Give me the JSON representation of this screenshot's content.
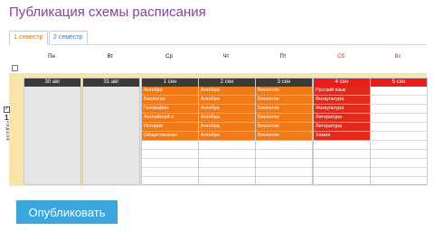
{
  "page": {
    "title": "Публикация схемы расписания"
  },
  "tabs": [
    {
      "label": "1 семестр",
      "active": true
    },
    {
      "label": "2 семестр",
      "active": false
    }
  ],
  "schedule": {
    "week": {
      "number": "1",
      "word": "неделя",
      "checked": true
    },
    "days": [
      {
        "label": "Пн",
        "date": "30 авг",
        "weekend": false,
        "inactive": true,
        "lessons": []
      },
      {
        "label": "Вт",
        "date": "31 авг",
        "weekend": false,
        "inactive": true,
        "lessons": []
      },
      {
        "label": "Ср",
        "date": "1 сен",
        "weekend": false,
        "inactive": false,
        "lessons": [
          "Алгебра",
          "Биология",
          "География",
          "Английский я",
          "История",
          "Обществознан"
        ]
      },
      {
        "label": "Чт",
        "date": "2 сен",
        "weekend": false,
        "inactive": false,
        "lessons": [
          "Алгебра",
          "Алгебра",
          "Алгебра",
          "Алгебра",
          "Алгебра",
          "Алгебра"
        ]
      },
      {
        "label": "Пт",
        "date": "3 сен",
        "weekend": false,
        "inactive": false,
        "lessons": [
          "Биология",
          "Биология",
          "Биология",
          "Биология",
          "Биология",
          "Биология"
        ]
      },
      {
        "label": "Сб",
        "date": "4 сен",
        "weekend": true,
        "inactive": false,
        "lessons": [
          "Русский язык",
          "Физкультура",
          "Физкультура",
          "Литература",
          "Литература",
          "Химия"
        ]
      },
      {
        "label": "Вс",
        "date": "5 сен",
        "weekend": true,
        "inactive": false,
        "lessons": []
      }
    ],
    "slots_per_day": 10
  },
  "publish_button": {
    "label": "Опубликовать"
  },
  "colors": {
    "title": "#8a3f9e",
    "active_tab": "#e07000",
    "inactive_tab": "#3d78c4",
    "lesson": "#f07918",
    "weekend_head": "#e61d1d",
    "week_band": "#f9e4ab",
    "button": "#3aa6dd"
  }
}
